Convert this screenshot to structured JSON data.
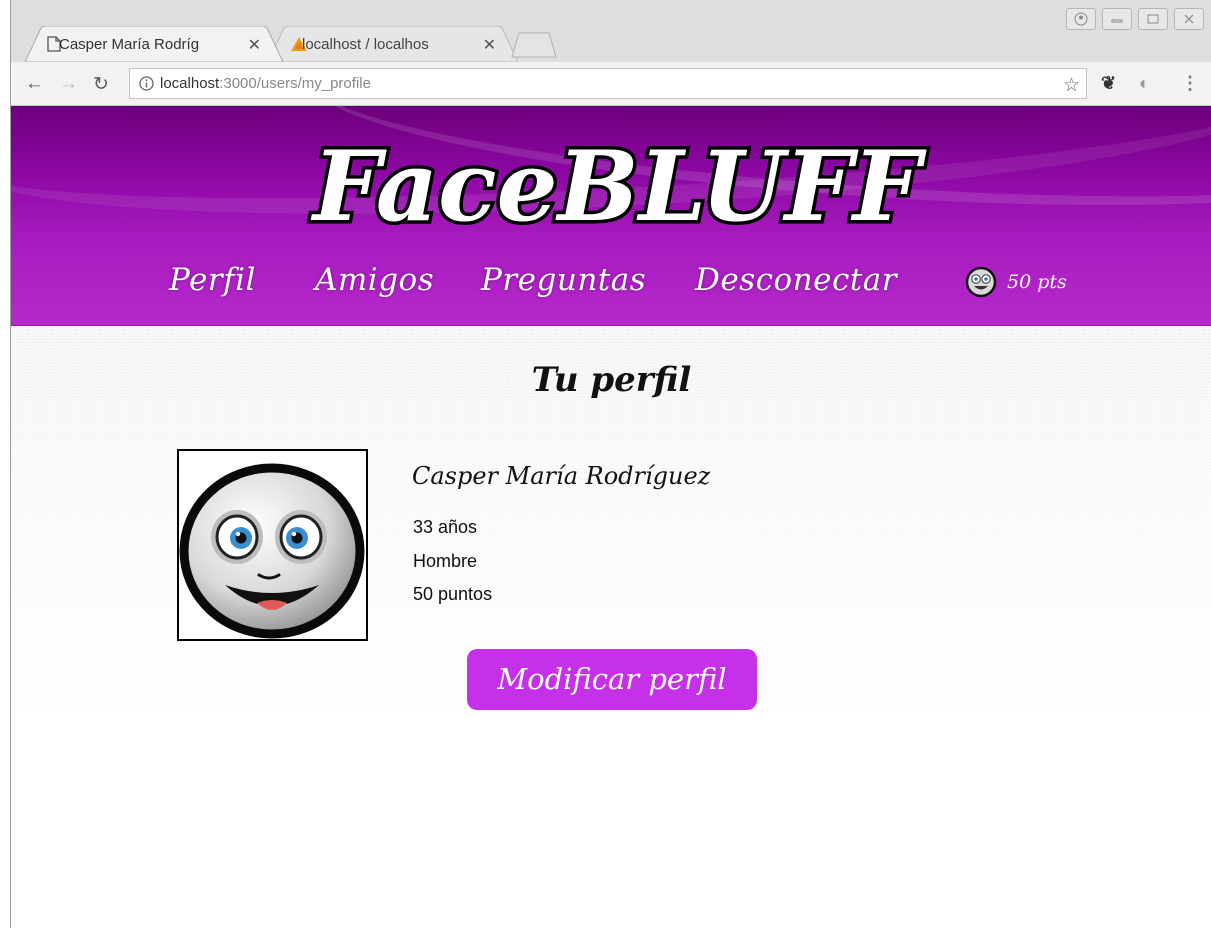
{
  "browser": {
    "tabs": [
      {
        "label": "Casper María Rodríg",
        "active": true
      },
      {
        "label": "localhost / localhos",
        "active": false
      }
    ],
    "url": {
      "host": "localhost",
      "path": ":3000/users/my_profile"
    }
  },
  "site": {
    "logo": "FaceBLUFF",
    "nav": [
      "Perfil",
      "Amigos",
      "Preguntas",
      "Desconectar"
    ],
    "points": "50 pts",
    "accent": "#c630e8",
    "header_color": "#9a14b3"
  },
  "profile": {
    "title": "Tu perfil",
    "name": "Casper María Rodríguez",
    "age": "33 años",
    "gender": "Hombre",
    "points": "50 puntos",
    "edit_button": "Modificar perfil"
  }
}
